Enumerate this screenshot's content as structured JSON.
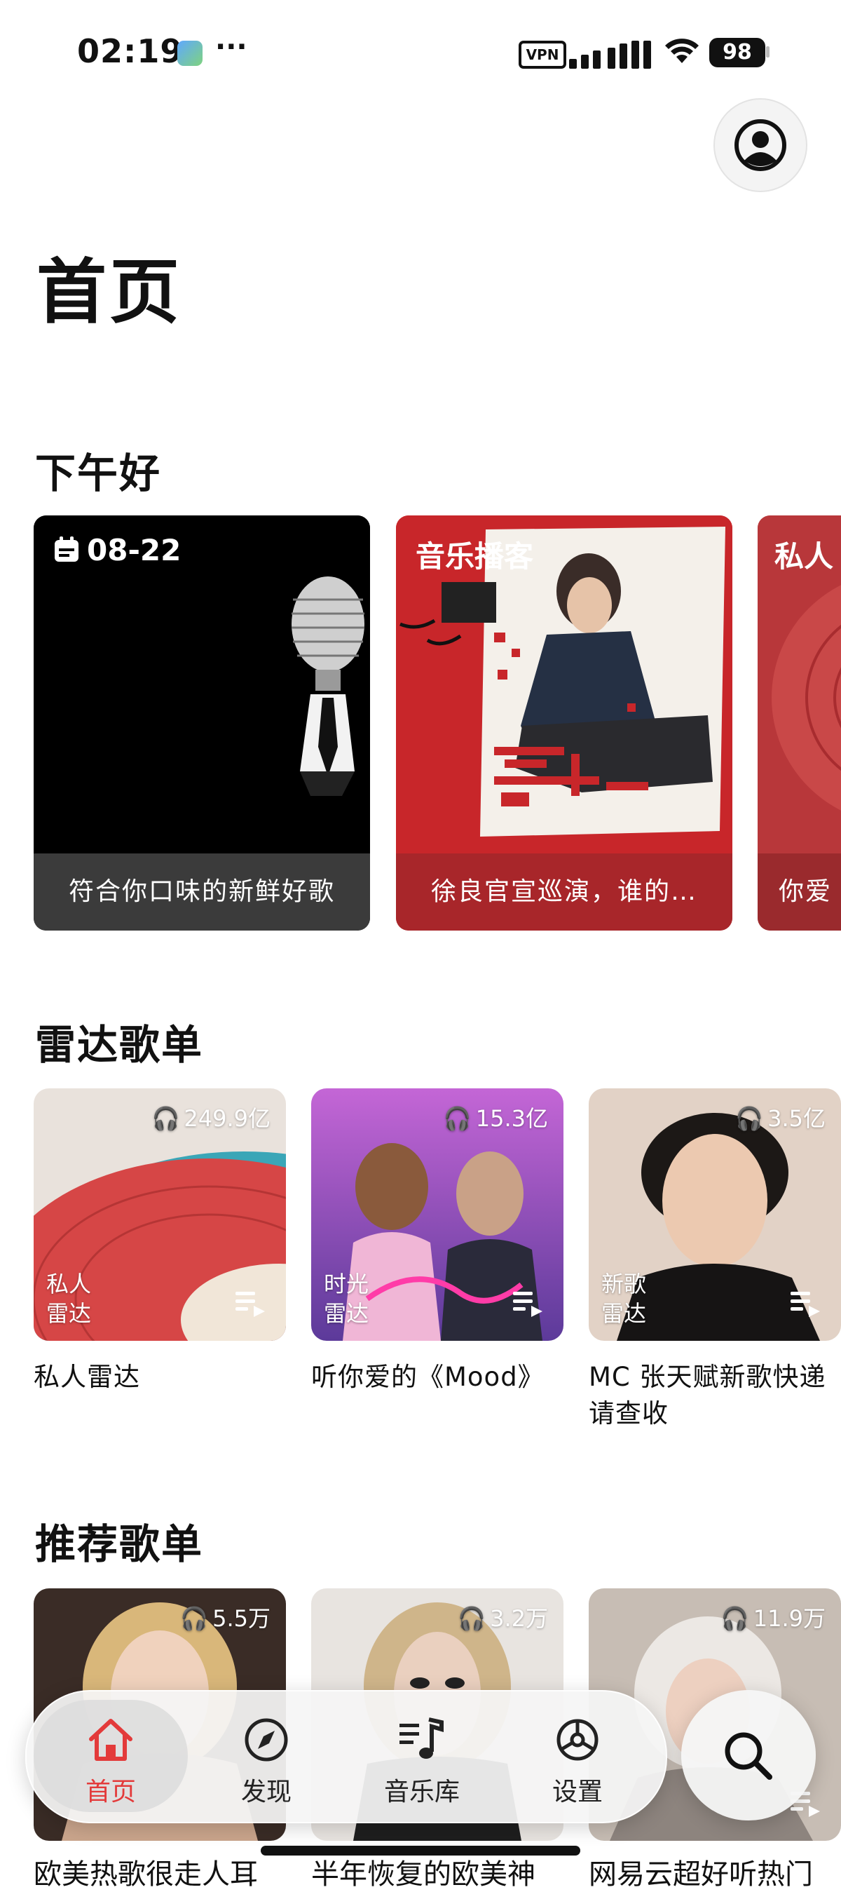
{
  "status_bar": {
    "time": "02:19",
    "more": "···",
    "vpn": "VPN",
    "battery": "98"
  },
  "page": {
    "title": "首页"
  },
  "sections": {
    "greeting": {
      "title": "下午好",
      "cards": [
        {
          "top_label": "08-22",
          "bottom_label": "符合你口味的新鲜好歌"
        },
        {
          "top_label": "音乐播客",
          "bottom_label": "徐良官宣巡演，谁的…"
        },
        {
          "top_label": "私人",
          "bottom_label": "你爱"
        }
      ]
    },
    "radar": {
      "title": "雷达歌单",
      "cards": [
        {
          "plays": "249.9亿",
          "corner": "私人\n雷达",
          "title": "私人雷达"
        },
        {
          "plays": "15.3亿",
          "corner": "时光\n雷达",
          "title": "听你爱的《Mood》"
        },
        {
          "plays": "3.5亿",
          "corner": "新歌\n雷达",
          "title": "MC 张天赋新歌快递请查收"
        }
      ]
    },
    "recommend": {
      "title": "推荐歌单",
      "cards": [
        {
          "plays": "5.5万",
          "title": "欧美热歌很走人耳"
        },
        {
          "plays": "3.2万",
          "title": "半年恢复的欧美神"
        },
        {
          "plays": "11.9万",
          "title": "网易云超好听热门"
        }
      ]
    }
  },
  "tabbar": {
    "tabs": [
      {
        "label": "首页",
        "icon": "home-icon",
        "active": true
      },
      {
        "label": "发现",
        "icon": "compass-icon"
      },
      {
        "label": "音乐库",
        "icon": "music-library-icon"
      },
      {
        "label": "设置",
        "icon": "settings-icon"
      }
    ],
    "search_icon": "search-icon"
  },
  "colors": {
    "accent": "#e33a3a",
    "podcast_red": "#c8262a"
  }
}
